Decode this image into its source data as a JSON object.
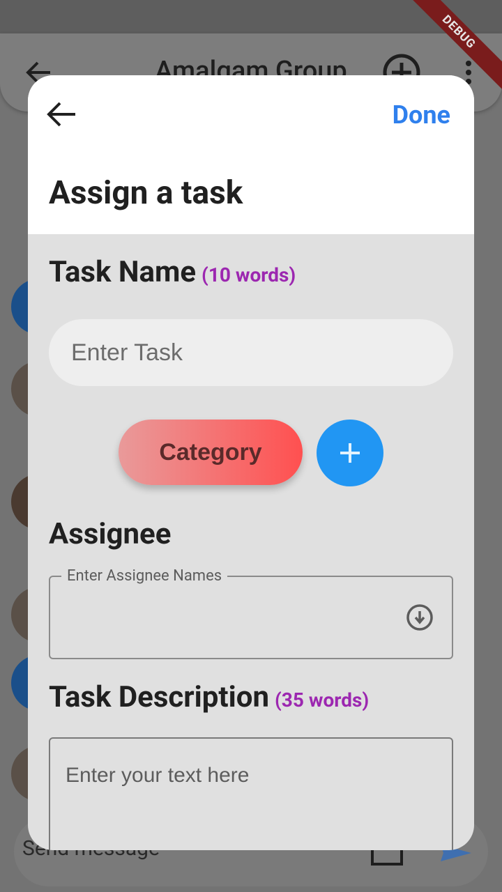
{
  "background": {
    "appbar_title": "Amalgam Group",
    "composer_placeholder": "Send message",
    "debug_banner": "DEBUG"
  },
  "modal": {
    "done_label": "Done",
    "title": "Assign a task",
    "task_name": {
      "label": "Task Name",
      "limit": "(10 words)",
      "placeholder": "Enter Task"
    },
    "category": {
      "label": "Category",
      "add_symbol": "+"
    },
    "assignee": {
      "label": "Assignee",
      "field_label": "Enter Assignee Names"
    },
    "description": {
      "label": "Task Description",
      "limit": "(35 words)",
      "placeholder": "Enter your text here"
    }
  },
  "colors": {
    "accent": "#2f80ed",
    "limit_purple": "#9c27b0",
    "fab_blue": "#2196f3",
    "category_start": "#e99a9a",
    "category_end": "#ff5050"
  }
}
